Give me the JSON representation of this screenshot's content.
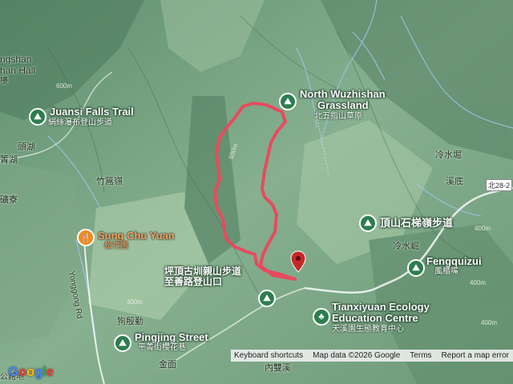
{
  "map": {
    "type": "terrain-map",
    "route_color": "#e84a5f",
    "poi_color": "#2e7d4f",
    "food_color": "#f08a24"
  },
  "pois": [
    {
      "id": "north-wuzhishan",
      "name_en": "North Wuzhishan",
      "name_en2": "Grassland",
      "name_zh": "北五指山草原",
      "icon": "hiking-icon"
    },
    {
      "id": "juansi-falls",
      "name_en": "Juansi Falls Trail",
      "name_zh": "絹絲瀑布登山步道",
      "icon": "hiking-icon"
    },
    {
      "id": "dingshan",
      "name_zh": "頂山石梯嶺步道",
      "icon": "hiking-icon"
    },
    {
      "id": "fengquizui",
      "name_en": "Fengquizui",
      "name_zh": "風櫃嘴",
      "icon": "hiking-icon"
    },
    {
      "id": "pingding",
      "name_zh": "坪頂古圳親山步道",
      "name_zh2": "至善路登山口",
      "icon": "hiking-icon"
    },
    {
      "id": "tianxiyuan",
      "name_en": "Tianxiyuan Ecology",
      "name_en2": "Education Centre",
      "name_zh": "天溪園生態教育中心",
      "icon": "tree-icon"
    },
    {
      "id": "pingjing",
      "name_en": "Pingjing Street",
      "name_zh": "平菁街櫻花巷",
      "icon": "hiking-icon"
    }
  ],
  "restaurant": {
    "name_en": "Sung Chu Yuan",
    "name_zh": "松竹園",
    "icon": "restaurant-icon"
  },
  "places": [
    "頭湖",
    "竹篙嶺",
    "冷水堀",
    "溪底",
    "冷水崛",
    "狗殷勤",
    "金面",
    "內雙溪"
  ],
  "partial_labels": [
    "ngshan",
    "han Hall",
    "樓",
    "箐湖",
    "礦寮",
    "公館地"
  ],
  "road": {
    "name": "Yonggong Rd",
    "shield": "北28-2"
  },
  "elevation_marks": [
    "600m",
    "600m",
    "400m",
    "400m",
    "400m",
    "400m"
  ],
  "footer": {
    "shortcuts": "Keyboard shortcuts",
    "map_data": "Map data ©2026 Google",
    "terms": "Terms",
    "report": "Report a map error"
  },
  "logo": "Google"
}
